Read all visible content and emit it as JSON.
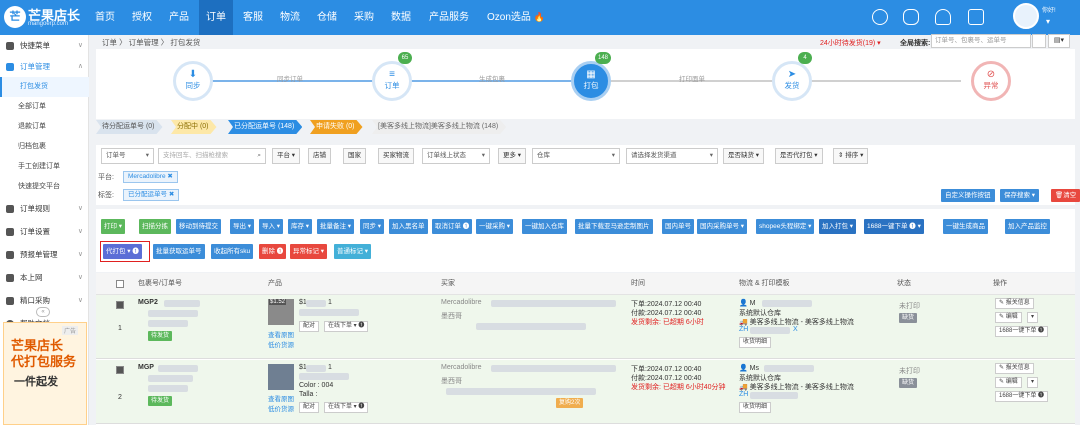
{
  "app": {
    "logo_badge": "芒",
    "name": "芒果店长",
    "sub": "mangoerp.com"
  },
  "nav": [
    "首页",
    "授权",
    "产品",
    "订单",
    "客服",
    "物流",
    "仓储",
    "采购",
    "数据",
    "产品服务",
    "Ozon选品"
  ],
  "nav_active": 3,
  "user": {
    "name": "你好!"
  },
  "sidebar": {
    "items": [
      "快捷菜单",
      "订单管理"
    ],
    "subitems": [
      "打包发货",
      "全部订单",
      "退款订单",
      "归档包裹",
      "手工创建订单",
      "快速提交平台"
    ],
    "items2": [
      "订单规则",
      "订单设置",
      "预报单管理",
      "本上网",
      "精口采购",
      "帮助文档"
    ],
    "ad": {
      "tag": "广告",
      "line1": "芒果店长",
      "line2": "代打包服务",
      "line3": "一件起发"
    }
  },
  "breadcrumb": "订单 〉 订单管理 〉 打包发货",
  "alert": "24小时待发货(19) ▾",
  "global_search": {
    "label": "全局搜索:",
    "placeholder": "订单号、包裹号、运单号"
  },
  "flow": {
    "steps": [
      {
        "label": "同步",
        "icon": "⬇",
        "badge": ""
      },
      {
        "label": "订单",
        "icon": "≡",
        "badge": "65"
      },
      {
        "label": "打包",
        "icon": "▦",
        "badge": "148"
      },
      {
        "label": "发货",
        "icon": "➤",
        "badge": "4"
      },
      {
        "label": "异常",
        "icon": "⊘",
        "badge": ""
      }
    ],
    "between": [
      "同步订单",
      "生成包裹",
      "打印面单"
    ]
  },
  "substeps": [
    "待分配运单号 (0)",
    "分配中 (0)",
    "已分配运单号 (148)",
    "申请失败 (0)",
    "[美客多线上物流]美客多线上物流 (148)"
  ],
  "filters": {
    "order_no": "订单号",
    "search_placeholder": "支持回车、扫描枪搜索",
    "platform": "平台",
    "store": "店铺",
    "country": "国家",
    "buyer_logistics": "买家物流",
    "online_status": "订单线上状态",
    "more": "更多",
    "warehouse": "仓库",
    "channel": "请选择发货渠道",
    "out_of_stock": "是否缺货",
    "proxy_pack": "是否代打包",
    "sort": "排序",
    "platform_label": "平台:",
    "platform_tag": "Mercadolibre",
    "tag_label": "标签:",
    "tag_value": "已分配运单号",
    "custom_btn": "自定义操作按钮",
    "save_search": "保存搜索",
    "clear": "清空"
  },
  "actions": {
    "row1": [
      "打印",
      "扫描分拣",
      "移动到待提交",
      "导出",
      "导入",
      "库存",
      "批量备注",
      "同步",
      "加入黑名单",
      "取消订单",
      "一键采购",
      "一键加入仓库",
      "批量下载亚马逊定制图片",
      "国内单号",
      "国内采购单号",
      "shopee头程绑定",
      "加入打包",
      "1688一键下单",
      "一键生成商品",
      "加入产品监控"
    ],
    "row2": [
      "代打包",
      "批量获取运单号",
      "收起所有sku",
      "删除",
      "异常标记",
      "普通标记"
    ]
  },
  "table": {
    "headers": [
      "包裹号/订单号",
      "产品",
      "买家",
      "时间",
      "物流 & 打印模板",
      "状态",
      "操作"
    ],
    "rows": [
      {
        "index": "1",
        "pkg": "MGP2",
        "prod_price": "$1",
        "qty": "1",
        "prod_label1": "查看原图",
        "prod_label2": "低价货源",
        "ship_btn": "配对",
        "online_btn": "在线下单",
        "platform": "Mercadolibre",
        "country": "墨西哥",
        "order_time": "下单:2024.07.12 00:40",
        "pay_time": "付款:2024.07.12 00:40",
        "remain": "发货剩余: 已超期 6小时",
        "logistics_user": "M",
        "warehouse": "系统默认仓库",
        "logistics": "美客多线上物流 - 美客多线上物流",
        "tracking": "ZH",
        "tk_suffix": "X",
        "btn_invoice": "收货明细",
        "status": "未打印",
        "status_badge": "缺货",
        "op_detail": "报关信息",
        "op_edit": "编辑",
        "op_1688": "1688一键下单",
        "pay_badge": "待发货",
        "thumb_label": "$1.52",
        "color": "",
        "size": "",
        "repeat": ""
      },
      {
        "index": "2",
        "pkg": "MGP",
        "prod_price": "$1",
        "qty": "1",
        "prod_label1": "查看原图",
        "prod_label2": "低价货源",
        "ship_btn": "配对",
        "online_btn": "在线下单",
        "platform": "Mercadolibre",
        "country": "墨西哥",
        "order_time": "下单:2024.07.12 00:40",
        "pay_time": "付款:2024.07.12 00:40",
        "remain": "发货剩余: 已超期 6小时40分钟",
        "logistics_user": "Ms",
        "warehouse": "系统默认仓库",
        "logistics": "美客多线上物流 - 美客多线上物流",
        "tracking": "ZH",
        "tk_suffix": "",
        "btn_invoice": "收货明细",
        "status": "未打印",
        "status_badge": "缺货",
        "op_detail": "报关信息",
        "op_edit": "编辑",
        "op_1688": "1688一键下单",
        "pay_badge": "待发货",
        "thumb_label": "",
        "color": "Color : 004",
        "size": "Talla :",
        "repeat": "复购2次"
      }
    ]
  },
  "colors": {
    "primary": "#2c8de3",
    "danger": "#e8483e",
    "success": "#5cb85c"
  }
}
